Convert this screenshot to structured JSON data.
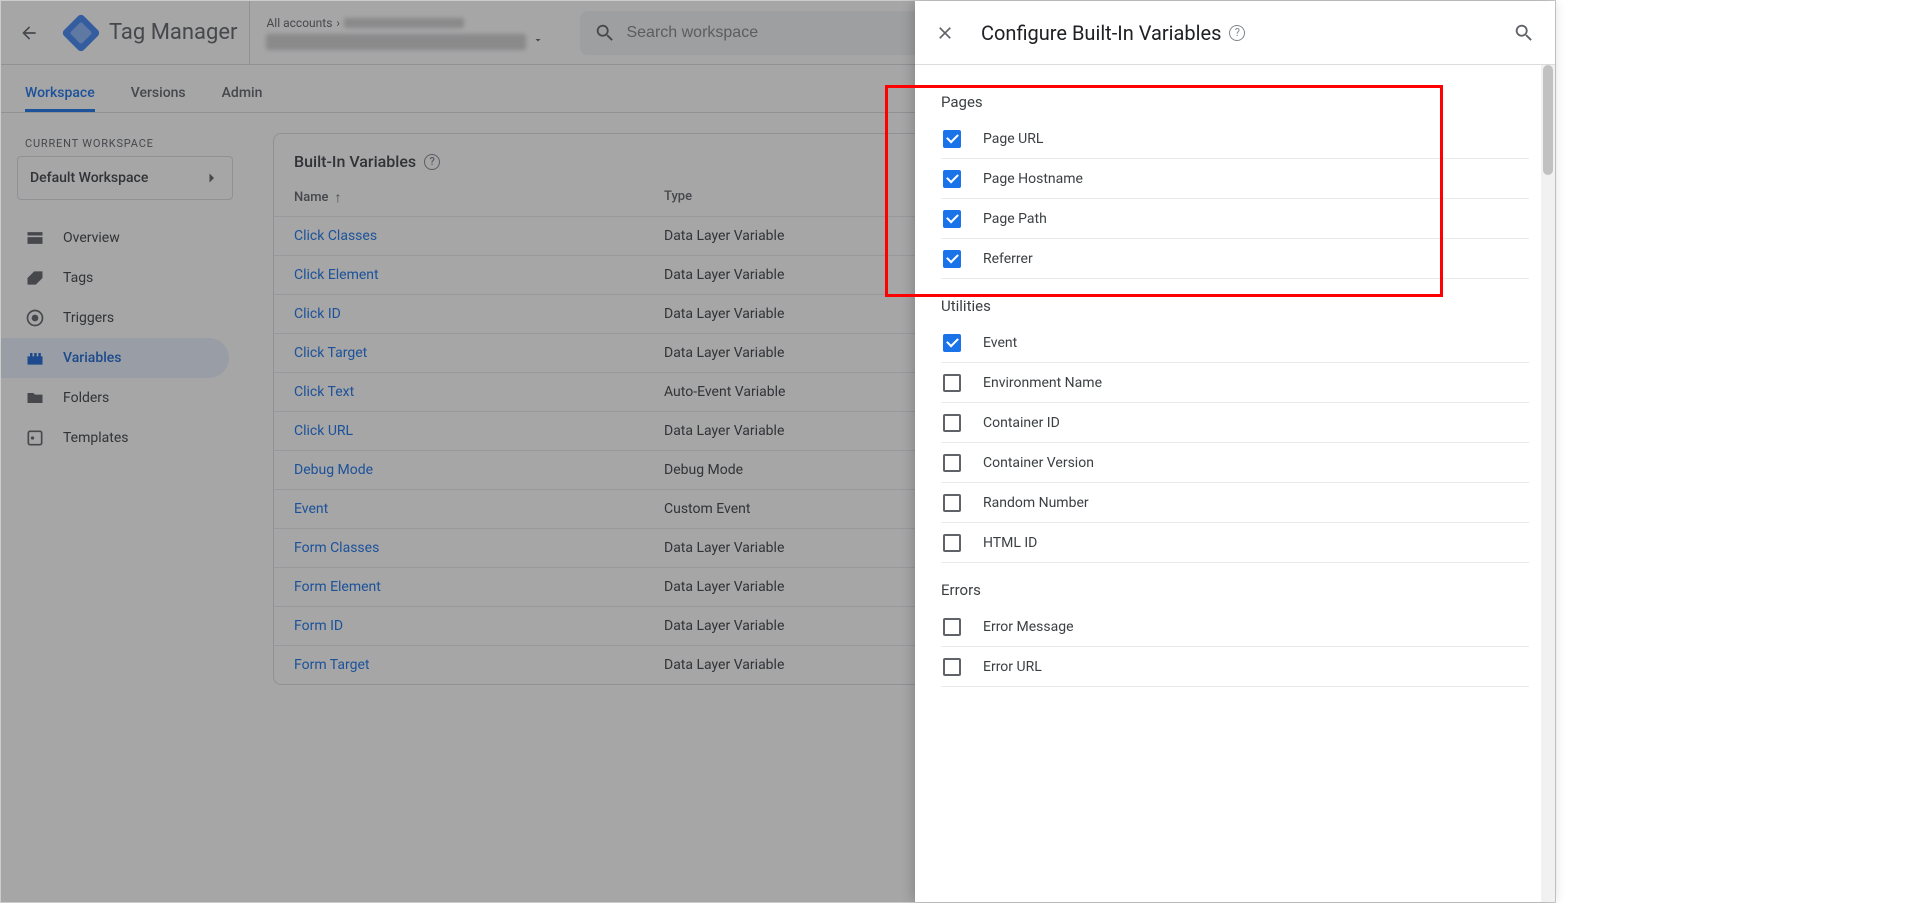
{
  "header": {
    "product_name": "Tag Manager",
    "breadcrumb_label": "All accounts",
    "search_placeholder": "Search workspace"
  },
  "tabs": [
    {
      "label": "Workspace",
      "active": true
    },
    {
      "label": "Versions",
      "active": false
    },
    {
      "label": "Admin",
      "active": false
    }
  ],
  "sidebar": {
    "current_workspace_label": "CURRENT WORKSPACE",
    "workspace_name": "Default Workspace",
    "items": [
      {
        "label": "Overview",
        "icon": "dashboard"
      },
      {
        "label": "Tags",
        "icon": "tag"
      },
      {
        "label": "Triggers",
        "icon": "target"
      },
      {
        "label": "Variables",
        "icon": "brick",
        "active": true
      },
      {
        "label": "Folders",
        "icon": "folder"
      },
      {
        "label": "Templates",
        "icon": "template"
      }
    ]
  },
  "card": {
    "title": "Built-In Variables",
    "columns": {
      "name": "Name",
      "type": "Type"
    },
    "rows": [
      {
        "name": "Click Classes",
        "type": "Data Layer Variable"
      },
      {
        "name": "Click Element",
        "type": "Data Layer Variable"
      },
      {
        "name": "Click ID",
        "type": "Data Layer Variable"
      },
      {
        "name": "Click Target",
        "type": "Data Layer Variable"
      },
      {
        "name": "Click Text",
        "type": "Auto-Event Variable"
      },
      {
        "name": "Click URL",
        "type": "Data Layer Variable"
      },
      {
        "name": "Debug Mode",
        "type": "Debug Mode"
      },
      {
        "name": "Event",
        "type": "Custom Event"
      },
      {
        "name": "Form Classes",
        "type": "Data Layer Variable"
      },
      {
        "name": "Form Element",
        "type": "Data Layer Variable"
      },
      {
        "name": "Form ID",
        "type": "Data Layer Variable"
      },
      {
        "name": "Form Target",
        "type": "Data Layer Variable"
      }
    ]
  },
  "panel": {
    "title": "Configure Built-In Variables",
    "sections": [
      {
        "title": "Pages",
        "items": [
          {
            "label": "Page URL",
            "checked": true
          },
          {
            "label": "Page Hostname",
            "checked": true
          },
          {
            "label": "Page Path",
            "checked": true
          },
          {
            "label": "Referrer",
            "checked": true
          }
        ]
      },
      {
        "title": "Utilities",
        "items": [
          {
            "label": "Event",
            "checked": true
          },
          {
            "label": "Environment Name",
            "checked": false
          },
          {
            "label": "Container ID",
            "checked": false
          },
          {
            "label": "Container Version",
            "checked": false
          },
          {
            "label": "Random Number",
            "checked": false
          },
          {
            "label": "HTML ID",
            "checked": false
          }
        ]
      },
      {
        "title": "Errors",
        "items": [
          {
            "label": "Error Message",
            "checked": false
          },
          {
            "label": "Error URL",
            "checked": false
          }
        ]
      }
    ]
  }
}
